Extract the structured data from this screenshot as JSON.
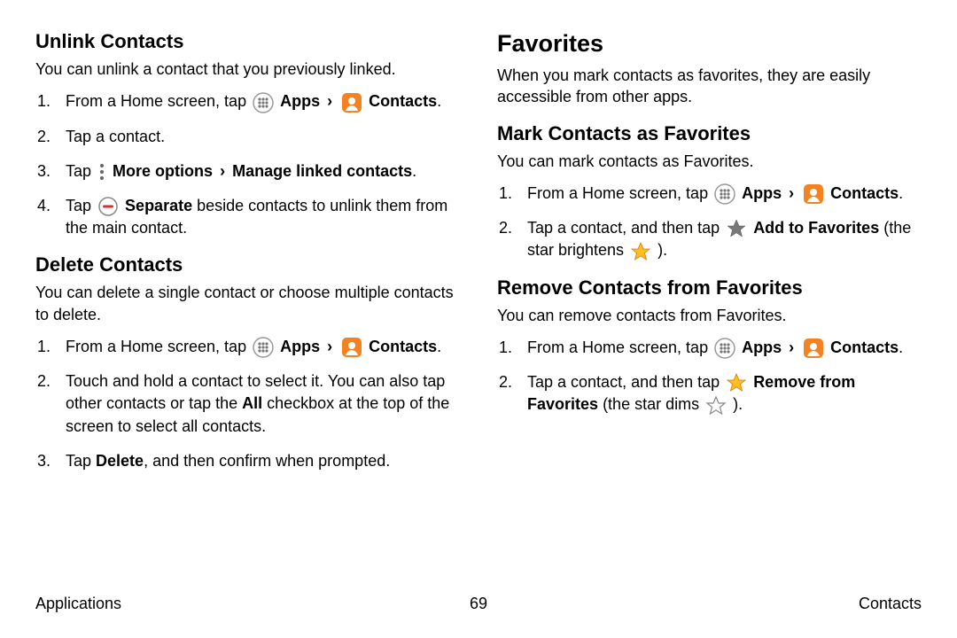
{
  "left": {
    "unlink": {
      "heading": "Unlink Contacts",
      "intro": "You can unlink a contact that you previously linked.",
      "steps": [
        {
          "pre": "From a Home screen, tap ",
          "apps": "Apps",
          "contacts": "Contacts",
          "post": "."
        },
        {
          "text": "Tap a contact."
        },
        {
          "pre": "Tap ",
          "more": "More options",
          "manage": "Manage linked contacts",
          "post": "."
        },
        {
          "pre": "Tap ",
          "sep": "Separate",
          "tail": " beside contacts to unlink them from the main contact."
        }
      ]
    },
    "delete": {
      "heading": "Delete Contacts",
      "intro": "You can delete a single contact or choose multiple contacts to delete.",
      "steps": [
        {
          "pre": "From a Home screen, tap ",
          "apps": "Apps",
          "contacts": "Contacts",
          "post": "."
        },
        {
          "pre": "Touch and hold a contact to select it. You can also tap other contacts or tap the ",
          "all": "All",
          "tail": " checkbox at the top of the screen to select all contacts."
        },
        {
          "pre": "Tap ",
          "del": "Delete",
          "tail": ", and then confirm when prompted."
        }
      ]
    }
  },
  "right": {
    "fav": {
      "heading": "Favorites",
      "intro": "When you mark contacts as favorites, they are easily accessible from other apps."
    },
    "mark": {
      "heading": "Mark Contacts as Favorites",
      "intro": "You can mark contacts as Favorites.",
      "steps": [
        {
          "pre": "From a Home screen, tap ",
          "apps": "Apps",
          "contacts": "Contacts",
          "post": "."
        },
        {
          "pre": "Tap a contact, and then tap ",
          "add": "Add to Favorites",
          "tail1": "(the star brightens ",
          "tail2": ")."
        }
      ]
    },
    "remove": {
      "heading": "Remove Contacts from Favorites",
      "intro": "You can remove contacts from Favorites.",
      "steps": [
        {
          "pre": "From a Home screen, tap ",
          "apps": "Apps",
          "contacts": "Contacts",
          "post": "."
        },
        {
          "pre": "Tap a contact, and then tap ",
          "rem": "Remove from Favorites",
          "tail1": " (the star dims ",
          "tail2": ")."
        }
      ]
    }
  },
  "footer": {
    "left": "Applications",
    "center": "69",
    "right": "Contacts"
  },
  "sep_breadcrumb": " › "
}
